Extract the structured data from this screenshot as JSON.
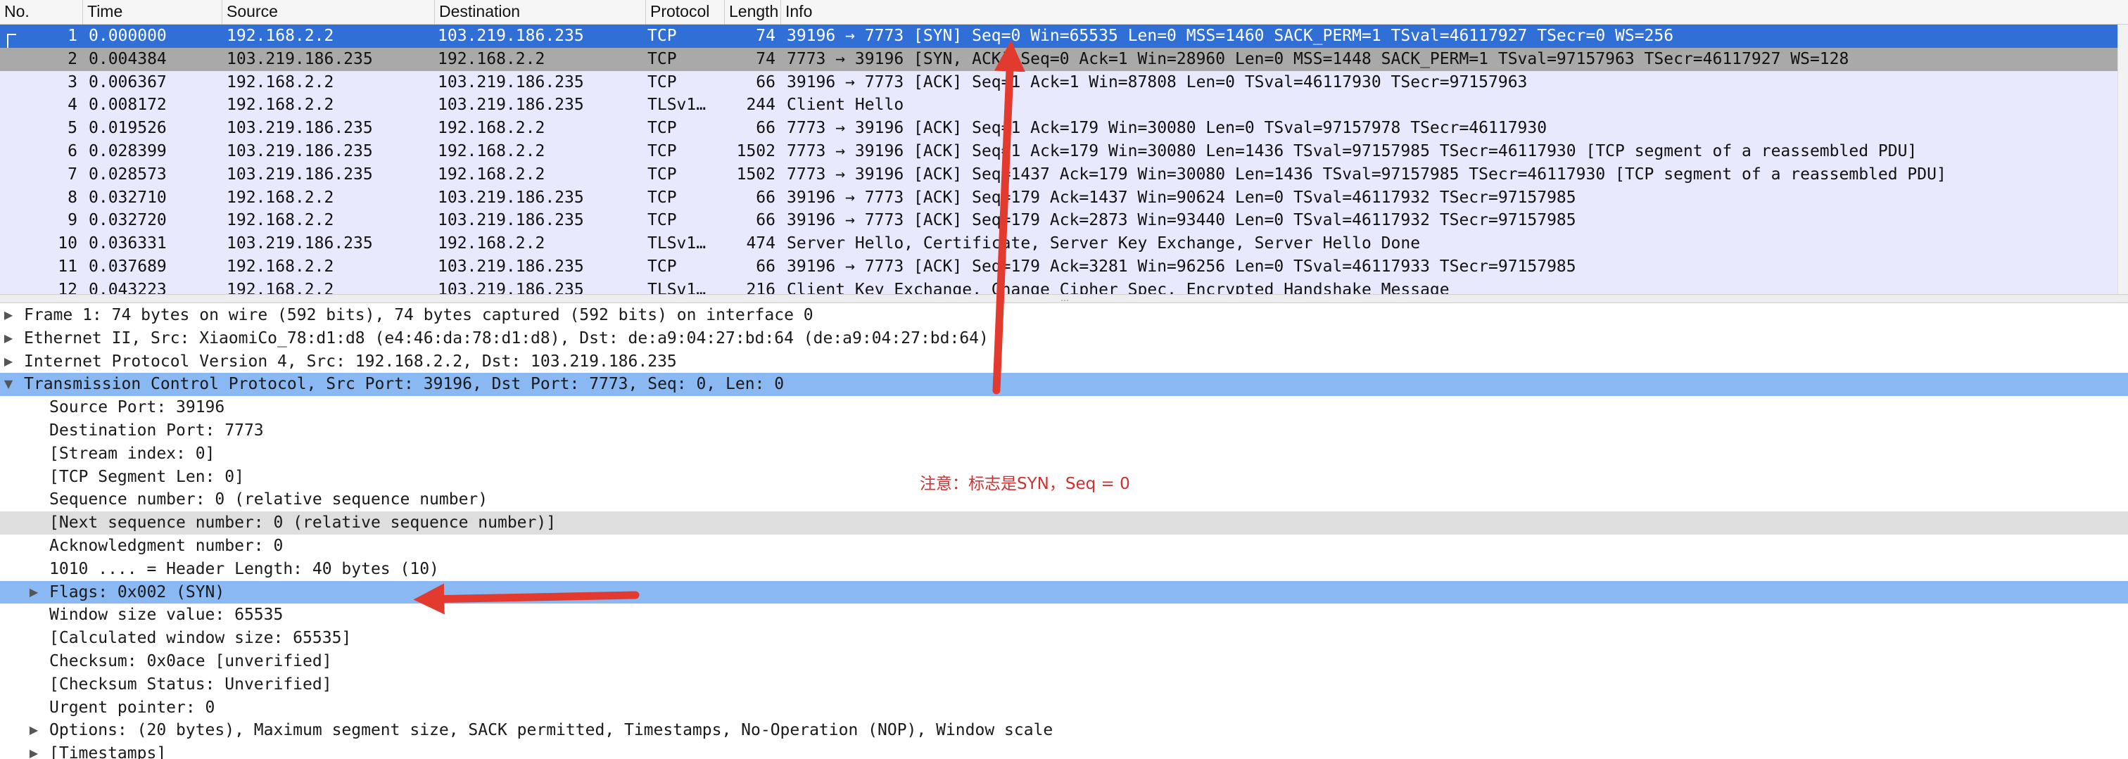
{
  "columns": {
    "no": "No.",
    "time": "Time",
    "source": "Source",
    "destination": "Destination",
    "protocol": "Protocol",
    "length": "Length",
    "info": "Info"
  },
  "packets": [
    {
      "no": "1",
      "time": "0.000000",
      "source": "192.168.2.2",
      "destination": "103.219.186.235",
      "protocol": "TCP",
      "length": "74",
      "info": "39196 → 7773 [SYN] Seq=0 Win=65535 Len=0 MSS=1460 SACK_PERM=1 TSval=46117927 TSecr=0 WS=256"
    },
    {
      "no": "2",
      "time": "0.004384",
      "source": "103.219.186.235",
      "destination": "192.168.2.2",
      "protocol": "TCP",
      "length": "74",
      "info": "7773 → 39196 [SYN, ACK] Seq=0 Ack=1 Win=28960 Len=0 MSS=1448 SACK_PERM=1 TSval=97157963 TSecr=46117927 WS=128"
    },
    {
      "no": "3",
      "time": "0.006367",
      "source": "192.168.2.2",
      "destination": "103.219.186.235",
      "protocol": "TCP",
      "length": "66",
      "info": "39196 → 7773 [ACK] Seq=1 Ack=1 Win=87808 Len=0 TSval=46117930 TSecr=97157963"
    },
    {
      "no": "4",
      "time": "0.008172",
      "source": "192.168.2.2",
      "destination": "103.219.186.235",
      "protocol": "TLSv1…",
      "length": "244",
      "info": "Client Hello"
    },
    {
      "no": "5",
      "time": "0.019526",
      "source": "103.219.186.235",
      "destination": "192.168.2.2",
      "protocol": "TCP",
      "length": "66",
      "info": "7773 → 39196 [ACK] Seq=1 Ack=179 Win=30080 Len=0 TSval=97157978 TSecr=46117930"
    },
    {
      "no": "6",
      "time": "0.028399",
      "source": "103.219.186.235",
      "destination": "192.168.2.2",
      "protocol": "TCP",
      "length": "1502",
      "info": "7773 → 39196 [ACK] Seq=1 Ack=179 Win=30080 Len=1436 TSval=97157985 TSecr=46117930 [TCP segment of a reassembled PDU]"
    },
    {
      "no": "7",
      "time": "0.028573",
      "source": "103.219.186.235",
      "destination": "192.168.2.2",
      "protocol": "TCP",
      "length": "1502",
      "info": "7773 → 39196 [ACK] Seq=1437 Ack=179 Win=30080 Len=1436 TSval=97157985 TSecr=46117930 [TCP segment of a reassembled PDU]"
    },
    {
      "no": "8",
      "time": "0.032710",
      "source": "192.168.2.2",
      "destination": "103.219.186.235",
      "protocol": "TCP",
      "length": "66",
      "info": "39196 → 7773 [ACK] Seq=179 Ack=1437 Win=90624 Len=0 TSval=46117932 TSecr=97157985"
    },
    {
      "no": "9",
      "time": "0.032720",
      "source": "192.168.2.2",
      "destination": "103.219.186.235",
      "protocol": "TCP",
      "length": "66",
      "info": "39196 → 7773 [ACK] Seq=179 Ack=2873 Win=93440 Len=0 TSval=46117932 TSecr=97157985"
    },
    {
      "no": "10",
      "time": "0.036331",
      "source": "103.219.186.235",
      "destination": "192.168.2.2",
      "protocol": "TLSv1…",
      "length": "474",
      "info": "Server Hello, Certificate, Server Key Exchange, Server Hello Done"
    },
    {
      "no": "11",
      "time": "0.037689",
      "source": "192.168.2.2",
      "destination": "103.219.186.235",
      "protocol": "TCP",
      "length": "66",
      "info": "39196 → 7773 [ACK] Seq=179 Ack=3281 Win=96256 Len=0 TSval=46117933 TSecr=97157985"
    },
    {
      "no": "12",
      "time": "0.043223",
      "source": "192.168.2.2",
      "destination": "103.219.186.235",
      "protocol": "TLSv1…",
      "length": "216",
      "info": "Client Key Exchange, Change Cipher Spec, Encrypted Handshake Message"
    }
  ],
  "details": [
    {
      "text": "Frame 1: 74 bytes on wire (592 bits), 74 bytes captured (592 bits) on interface 0",
      "expand": "▶"
    },
    {
      "text": "Ethernet II, Src: XiaomiCo_78:d1:d8 (e4:46:da:78:d1:d8), Dst: de:a9:04:27:bd:64 (de:a9:04:27:bd:64)",
      "expand": "▶"
    },
    {
      "text": "Internet Protocol Version 4, Src: 192.168.2.2, Dst: 103.219.186.235",
      "expand": "▶"
    },
    {
      "text": "Transmission Control Protocol, Src Port: 39196, Dst Port: 7773, Seq: 0, Len: 0",
      "expand": "▼"
    },
    {
      "text": "Source Port: 39196",
      "expand": ""
    },
    {
      "text": "Destination Port: 7773",
      "expand": ""
    },
    {
      "text": "[Stream index: 0]",
      "expand": ""
    },
    {
      "text": "[TCP Segment Len: 0]",
      "expand": ""
    },
    {
      "text": "Sequence number: 0    (relative sequence number)",
      "expand": ""
    },
    {
      "text": "[Next sequence number: 0    (relative sequence number)]",
      "expand": ""
    },
    {
      "text": "Acknowledgment number: 0",
      "expand": ""
    },
    {
      "text": "1010 .... = Header Length: 40 bytes (10)",
      "expand": ""
    },
    {
      "text": "Flags: 0x002 (SYN)",
      "expand": "▶"
    },
    {
      "text": "Window size value: 65535",
      "expand": ""
    },
    {
      "text": "[Calculated window size: 65535]",
      "expand": ""
    },
    {
      "text": "Checksum: 0x0ace [unverified]",
      "expand": ""
    },
    {
      "text": "[Checksum Status: Unverified]",
      "expand": ""
    },
    {
      "text": "Urgent pointer: 0",
      "expand": ""
    },
    {
      "text": "Options: (20 bytes), Maximum segment size, SACK permitted, Timestamps, No-Operation (NOP), Window scale",
      "expand": "▶"
    },
    {
      "text": "[Timestamps]",
      "expand": "▶"
    }
  ],
  "annotation": {
    "note": "注意：标志是SYN，Seq = 0",
    "color": "#d03030"
  },
  "colors": {
    "selected_row": "#2f6fd6",
    "highlight_row": "#8ab8f2",
    "packet_bg": "#e9e9fd",
    "related_row": "#a9a9a9"
  }
}
